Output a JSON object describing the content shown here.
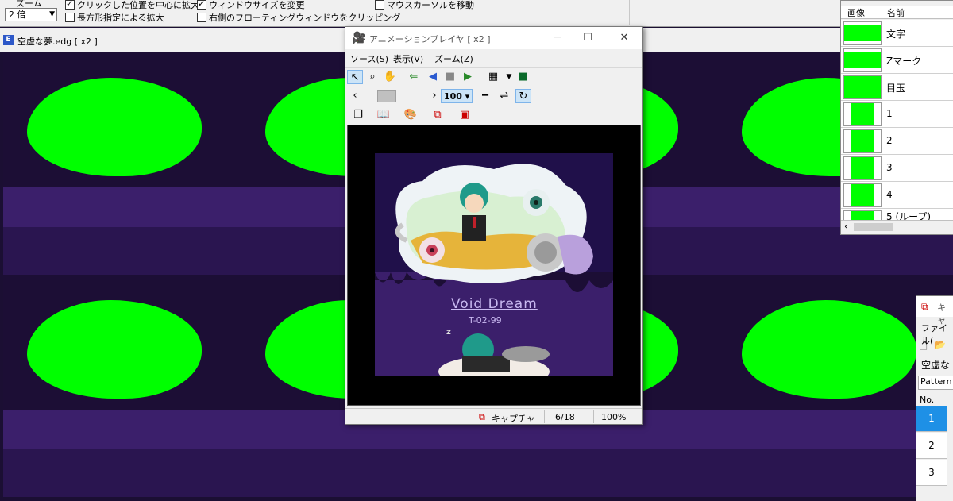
{
  "toolbar": {
    "zoom_label": "ズーム",
    "zoom_value": "2 倍",
    "options": [
      {
        "label": "クリックした位置を中心に拡大",
        "checked": true
      },
      {
        "label": "長方形指定による拡大",
        "checked": false
      },
      {
        "label": "ウィンドウサイズを変更",
        "checked": true
      },
      {
        "label": "右側のフローティングウィンドウをクリッピング",
        "checked": false
      },
      {
        "label": "マウスカーソルを移動",
        "checked": false
      }
    ]
  },
  "main_window": {
    "title": "空虚な夢.edg [ x2 ]",
    "icon": "edge-app-icon"
  },
  "player": {
    "title": "アニメーションプレイヤ [ x2 ]",
    "menu": [
      "ソース(S)",
      "表示(V)",
      "ズーム(Z)"
    ],
    "speed": "100",
    "scene_title": "Void Dream",
    "scene_subtitle": "T-02-99",
    "scene_zz": "z",
    "status": {
      "capture": "キャプチャ",
      "frame": "6/18",
      "zoom": "100%"
    },
    "colors": {
      "sky": "#20104a",
      "ground": "#3b1f6b"
    }
  },
  "layer_panel": {
    "headers": [
      "画像",
      "名前"
    ],
    "rows": [
      "文字",
      "Zマーク",
      "目玉",
      "1",
      "2",
      "3",
      "4",
      "5 (ループ)"
    ]
  },
  "capture_window": {
    "title": "キャ",
    "menu": "ファイル(",
    "name": "空虚な",
    "tab": "Pattern",
    "col": "No.",
    "rows": [
      "1",
      "2",
      "3"
    ]
  },
  "colors": {
    "accent_green": "#00ff00",
    "purple_dark": "#1c0e35",
    "purple_mid": "#3b1f6b",
    "selection": "#cce4f7"
  }
}
